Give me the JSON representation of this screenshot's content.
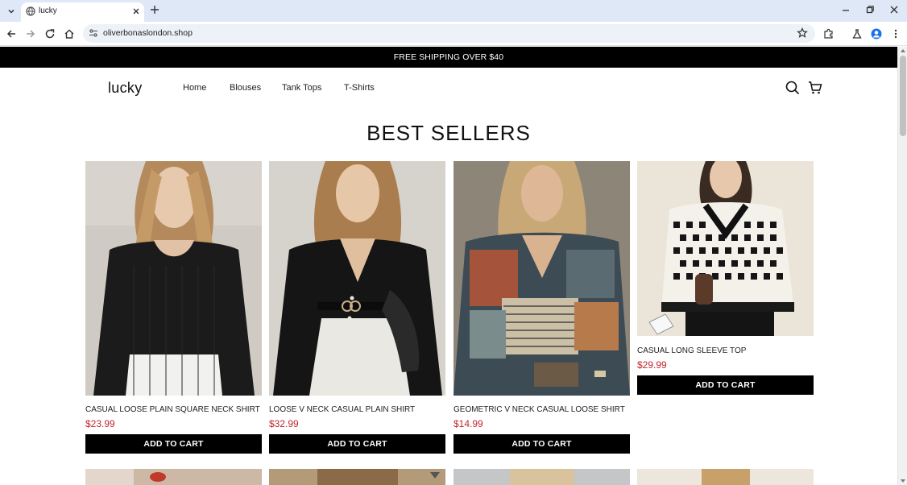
{
  "browser": {
    "tab_title": "lucky",
    "url": "oliverbonaslondon.shop"
  },
  "announcement": "FREE SHIPPING OVER $40",
  "header": {
    "logo": "lucky",
    "nav": [
      "Home",
      "Blouses",
      "Tank Tops",
      "T-Shirts"
    ]
  },
  "section_title": "BEST SELLERS",
  "products": [
    {
      "name": "CASUAL LOOSE PLAIN SQUARE NECK SHIRT",
      "price": "$23.99",
      "button": "ADD TO CART"
    },
    {
      "name": "LOOSE V NECK CASUAL PLAIN SHIRT",
      "price": "$32.99",
      "button": "ADD TO CART"
    },
    {
      "name": "GEOMETRIC V NECK CASUAL LOOSE SHIRT",
      "price": "$14.99",
      "button": "ADD TO CART"
    },
    {
      "name": "CASUAL LONG SLEEVE TOP",
      "price": "$29.99",
      "button": "ADD TO CART"
    }
  ],
  "colors": {
    "price": "#c1272d",
    "announcement_bg": "#000000",
    "button_bg": "#000000"
  }
}
